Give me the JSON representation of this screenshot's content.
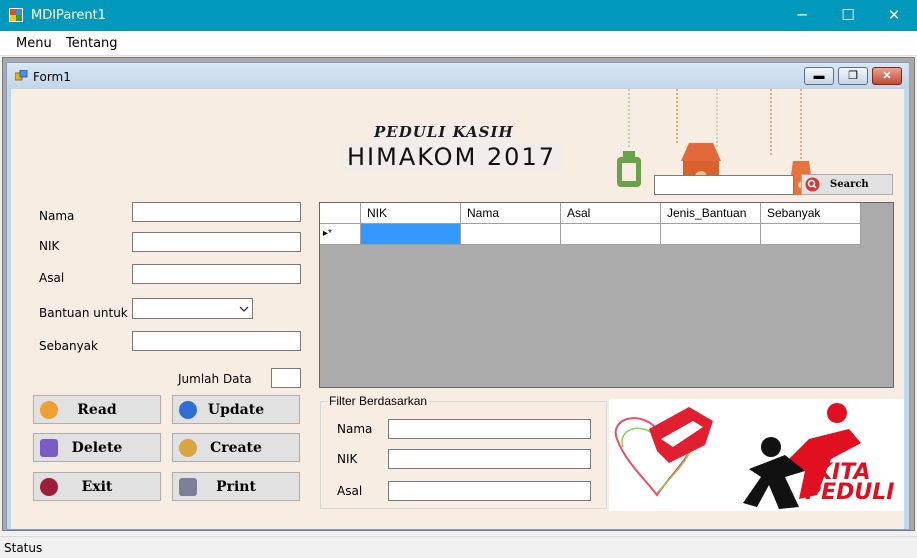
{
  "window": {
    "title": "MDIParent1",
    "minimize": "─",
    "maximize": "☐",
    "close": "✕"
  },
  "menu": {
    "items": [
      "Menu",
      "Tentang"
    ]
  },
  "child": {
    "title": "Form1"
  },
  "header": {
    "line1": "PEDULI KASIH",
    "line2": "HIMAKOM 2017"
  },
  "search": {
    "value": "",
    "button_label": "Search"
  },
  "form": {
    "nama_label": "Nama",
    "nama_value": "",
    "nik_label": "NIK",
    "nik_value": "",
    "asal_label": "Asal",
    "asal_value": "",
    "bantuan_label": "Bantuan untuk",
    "bantuan_value": "",
    "sebanyak_label": "Sebanyak",
    "sebanyak_value": "",
    "jumlah_label": "Jumlah Data",
    "jumlah_value": ""
  },
  "buttons": {
    "read": "Read",
    "update": "Update",
    "delete": "Delete",
    "create": "Create",
    "exit": "Exit",
    "print": "Print"
  },
  "grid": {
    "columns": [
      "NIK",
      "Nama",
      "Asal",
      "Jenis_Bantuan",
      "Sebanyak"
    ],
    "new_row_marker": "▸*"
  },
  "filter": {
    "legend": "Filter Berdasarkan",
    "nama_label": "Nama",
    "nik_label": "NIK",
    "asal_label": "Asal"
  },
  "logo": {
    "text_line1": "KITA",
    "text_line2": "PEDULI"
  },
  "status": {
    "text": "Status"
  },
  "colors": {
    "titlebar": "#0099bc",
    "selected_cell": "#3399ff",
    "logo_red": "#e01020"
  }
}
